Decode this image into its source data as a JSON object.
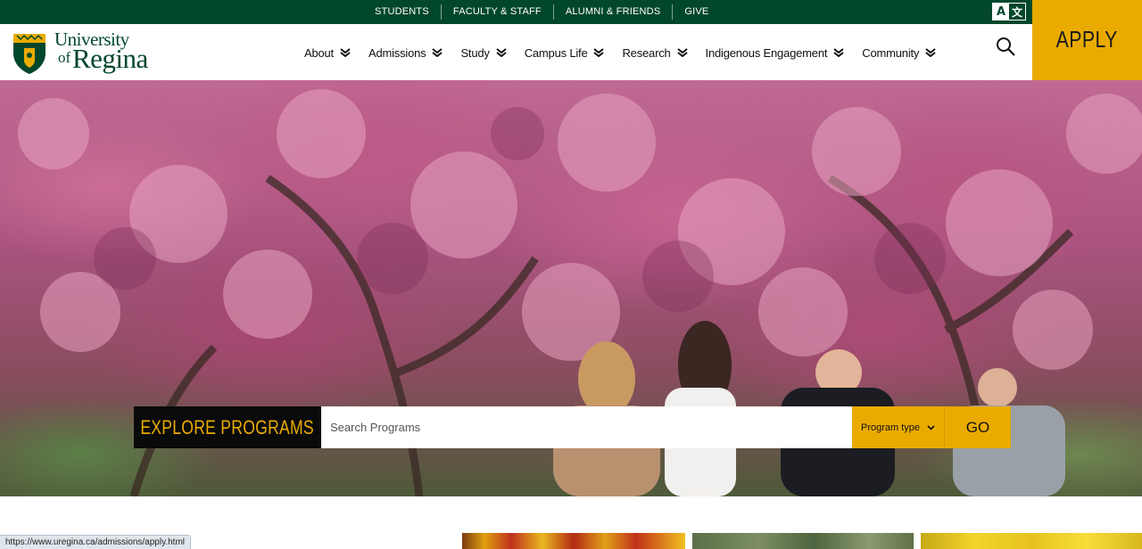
{
  "utility_nav": {
    "links": [
      "STUDENTS",
      "FACULTY & STAFF",
      "ALUMNI & FRIENDS",
      "GIVE"
    ]
  },
  "translate": {
    "icon": "translate-icon"
  },
  "apply": {
    "label": "APPLY"
  },
  "logo": {
    "line1": "University",
    "of": "of",
    "name": "Regina",
    "icon": "crest-icon"
  },
  "main_nav": {
    "items": [
      {
        "label": "About"
      },
      {
        "label": "Admissions"
      },
      {
        "label": "Study"
      },
      {
        "label": "Campus Life"
      },
      {
        "label": "Research"
      },
      {
        "label": "Indigenous Engagement"
      },
      {
        "label": "Community"
      }
    ],
    "chevron_icon": "double-chevron-down-icon"
  },
  "search": {
    "icon": "search-icon"
  },
  "program_search": {
    "title": "EXPLORE PROGRAMS",
    "placeholder": "Search Programs",
    "type_label": "Program type",
    "go_label": "GO"
  },
  "status_bar": {
    "url": "https://www.uregina.ca/admissions/apply.html"
  },
  "colors": {
    "brand_green": "#00472c",
    "brand_gold": "#eaab00",
    "dark": "#0a0a0a"
  }
}
